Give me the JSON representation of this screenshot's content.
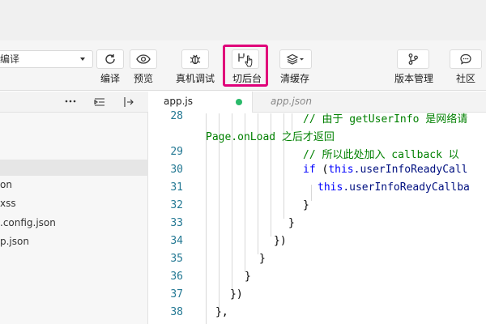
{
  "toolbar": {
    "mode_select_value": "编译",
    "tools": [
      {
        "label": "编译",
        "icon": "refresh-icon"
      },
      {
        "label": "预览",
        "icon": "eye-icon"
      },
      {
        "label": "真机调试",
        "icon": "bug-icon"
      },
      {
        "label": "切后台",
        "icon": "switch-background-icon"
      },
      {
        "label": "清缓存",
        "icon": "layers-icon"
      },
      {
        "label": "版本管理",
        "icon": "branch-icon"
      },
      {
        "label": "社区",
        "icon": "chat-icon"
      }
    ],
    "highlight_color": "#e0007a"
  },
  "sidebar": {
    "header_icons": [
      "more-icon",
      "collapse-icon",
      "split-icon"
    ],
    "files": [
      {
        "name": "on"
      },
      {
        "name": "xss"
      },
      {
        "name": ".config.json"
      },
      {
        "name": "p.json"
      }
    ]
  },
  "tabs": [
    {
      "label": "app.js",
      "status": "modified",
      "status_color": "#2aba6a"
    },
    {
      "label": "app.json"
    }
  ],
  "editor": {
    "lines": [
      {
        "num": "28",
        "parts": [
          {
            "t": "// 由于 getUserInfo 是网络请",
            "c": "comment"
          }
        ]
      },
      {
        "num": "",
        "parts": [
          {
            "t": "Page.onLoad 之后才返回",
            "c": "comment"
          }
        ]
      },
      {
        "num": "29",
        "parts": [
          {
            "t": "// 所以此处加入 callback 以",
            "c": "comment"
          }
        ]
      },
      {
        "num": "30",
        "parts": [
          {
            "t": "if",
            "c": "kw"
          },
          {
            "t": " (",
            "c": "plain"
          },
          {
            "t": "this",
            "c": "kw"
          },
          {
            "t": ".userInfoReadyCall",
            "c": "prop"
          }
        ]
      },
      {
        "num": "31",
        "parts": [
          {
            "t": "this",
            "c": "kw"
          },
          {
            "t": ".userInfoReadyCallba",
            "c": "prop"
          }
        ]
      },
      {
        "num": "32",
        "parts": [
          {
            "t": "}",
            "c": "plain"
          }
        ]
      },
      {
        "num": "33",
        "parts": [
          {
            "t": "}",
            "c": "plain"
          }
        ]
      },
      {
        "num": "34",
        "parts": [
          {
            "t": "})",
            "c": "plain"
          }
        ]
      },
      {
        "num": "35",
        "parts": [
          {
            "t": "}",
            "c": "plain"
          }
        ]
      },
      {
        "num": "36",
        "parts": [
          {
            "t": "}",
            "c": "plain"
          }
        ]
      },
      {
        "num": "37",
        "parts": [
          {
            "t": "})",
            "c": "plain"
          }
        ]
      },
      {
        "num": "38",
        "parts": [
          {
            "t": "},",
            "c": "plain"
          }
        ]
      }
    ],
    "colors": {
      "line_number": "#237893",
      "comment": "#008000",
      "keyword": "#0000ff",
      "property": "#001080"
    }
  }
}
